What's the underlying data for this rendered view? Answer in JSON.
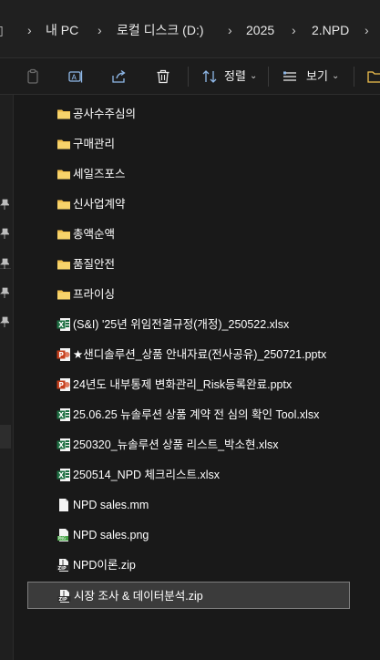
{
  "breadcrumb": [
    "내 PC",
    "로컬 디스크 (D:)",
    "2025",
    "2.NPD"
  ],
  "toolbar": {
    "sort_label": "정렬",
    "view_label": "보기"
  },
  "files": [
    {
      "name": "공사수주심의",
      "type": "folder"
    },
    {
      "name": "구매관리",
      "type": "folder"
    },
    {
      "name": "세일즈포스",
      "type": "folder"
    },
    {
      "name": "신사업계약",
      "type": "folder"
    },
    {
      "name": "총액순액",
      "type": "folder"
    },
    {
      "name": "품질안전",
      "type": "folder"
    },
    {
      "name": "프라이싱",
      "type": "folder"
    },
    {
      "name": "(S&I) '25년 위임전결규정(개정)_250522.xlsx",
      "type": "xlsx"
    },
    {
      "name": "★샌디솔루션_상품 안내자료(전사공유)_250721.pptx",
      "type": "pptx"
    },
    {
      "name": "24년도 내부통제 변화관리_Risk등록완료.pptx",
      "type": "pptx"
    },
    {
      "name": "25.06.25 뉴솔루션 상품 계약 전 심의 확인 Tool.xlsx",
      "type": "xlsx"
    },
    {
      "name": "250320_뉴솔루션 상품 리스트_박소현.xlsx",
      "type": "xlsx"
    },
    {
      "name": "250514_NPD 체크리스트.xlsx",
      "type": "xlsx"
    },
    {
      "name": "NPD sales.mm",
      "type": "file"
    },
    {
      "name": "NPD sales.png",
      "type": "png"
    },
    {
      "name": "NPD이론.zip",
      "type": "zip"
    },
    {
      "name": "시장 조사 & 데이터분석.zip",
      "type": "zip",
      "selected": true
    }
  ],
  "colors": {
    "folder": "#f2c14e",
    "excel": "#1d6f42",
    "powerpoint": "#c43e1c",
    "selection_bg": "#3b3b3b",
    "selection_border": "#7d7d7d"
  }
}
